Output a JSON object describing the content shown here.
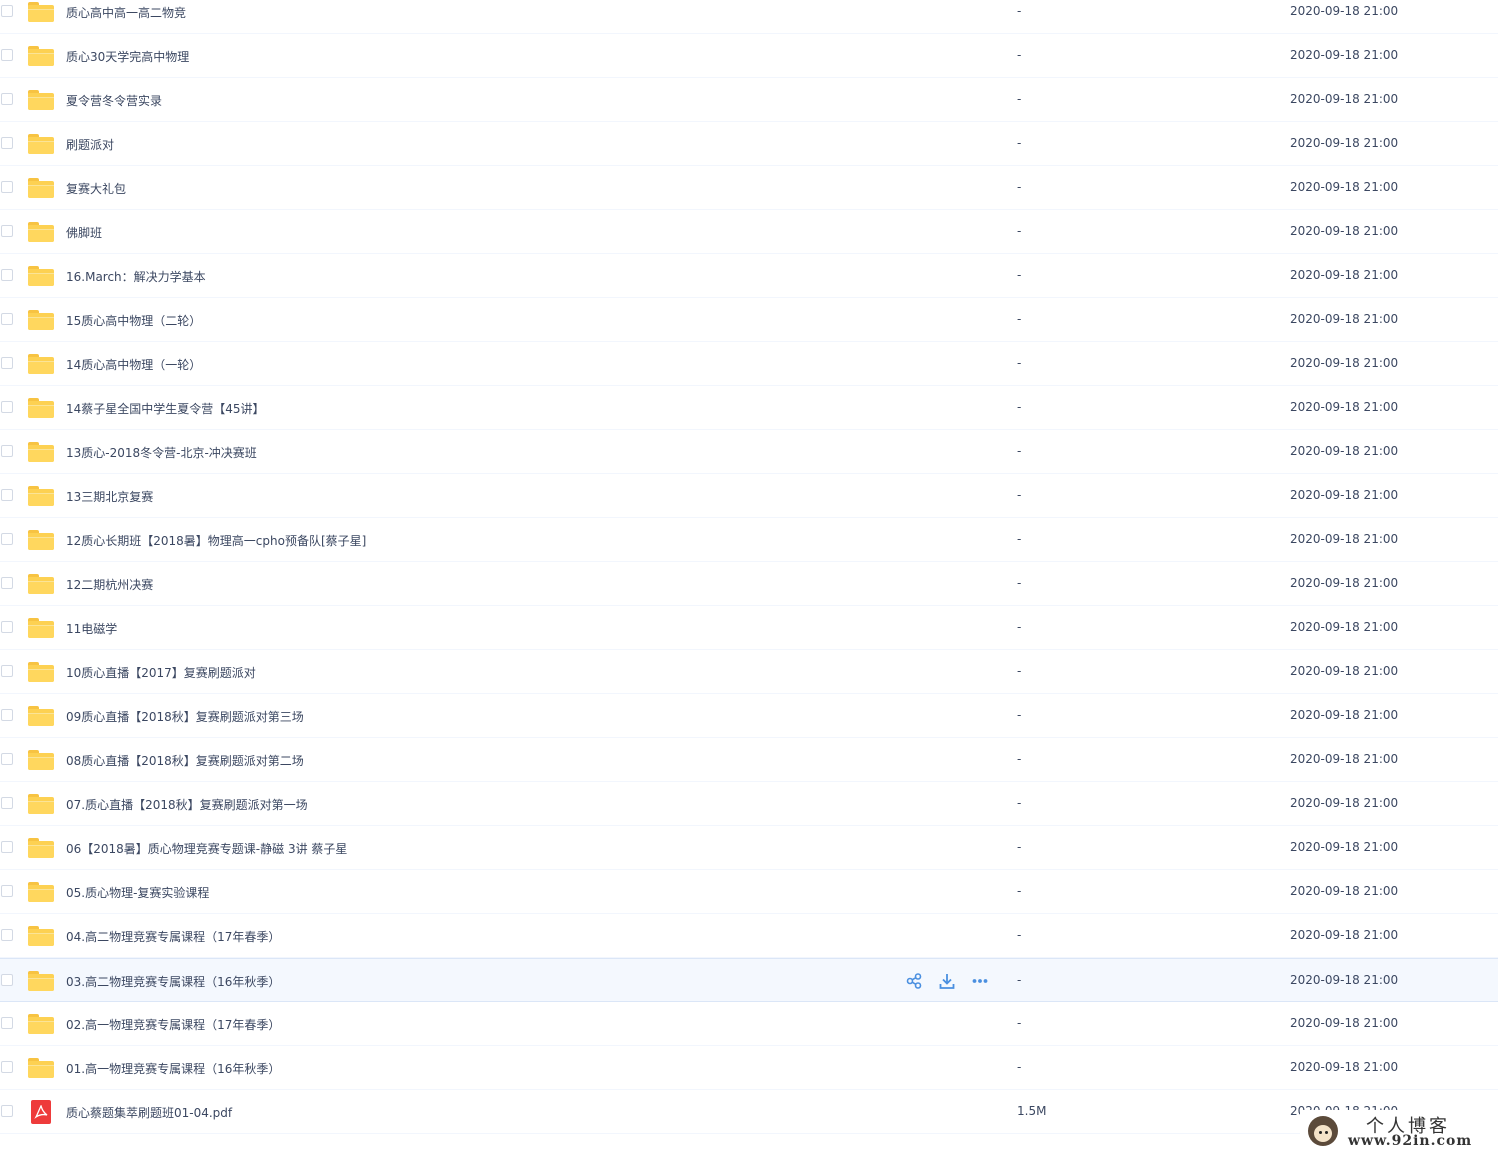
{
  "rows": [
    {
      "name": "质心高中高一高二物竞",
      "size": "-",
      "date": "2020-09-18 21:00",
      "type": "folder"
    },
    {
      "name": "质心30天学完高中物理",
      "size": "-",
      "date": "2020-09-18 21:00",
      "type": "folder"
    },
    {
      "name": "夏令营冬令营实录",
      "size": "-",
      "date": "2020-09-18 21:00",
      "type": "folder"
    },
    {
      "name": "刷题派对",
      "size": "-",
      "date": "2020-09-18 21:00",
      "type": "folder"
    },
    {
      "name": "复赛大礼包",
      "size": "-",
      "date": "2020-09-18 21:00",
      "type": "folder"
    },
    {
      "name": "佛脚班",
      "size": "-",
      "date": "2020-09-18 21:00",
      "type": "folder"
    },
    {
      "name": "16.March：解决力学基本",
      "size": "-",
      "date": "2020-09-18 21:00",
      "type": "folder"
    },
    {
      "name": "15质心高中物理（二轮）",
      "size": "-",
      "date": "2020-09-18 21:00",
      "type": "folder"
    },
    {
      "name": "14质心高中物理（一轮）",
      "size": "-",
      "date": "2020-09-18 21:00",
      "type": "folder"
    },
    {
      "name": "14蔡子星全国中学生夏令营【45讲】",
      "size": "-",
      "date": "2020-09-18 21:00",
      "type": "folder"
    },
    {
      "name": "13质心-2018冬令营-北京-冲决赛班",
      "size": "-",
      "date": "2020-09-18 21:00",
      "type": "folder"
    },
    {
      "name": "13三期北京复赛",
      "size": "-",
      "date": "2020-09-18 21:00",
      "type": "folder"
    },
    {
      "name": "12质心长期班【2018暑】物理高一cpho预备队[蔡子星]",
      "size": "-",
      "date": "2020-09-18 21:00",
      "type": "folder"
    },
    {
      "name": "12二期杭州决赛",
      "size": "-",
      "date": "2020-09-18 21:00",
      "type": "folder"
    },
    {
      "name": "11电磁学",
      "size": "-",
      "date": "2020-09-18 21:00",
      "type": "folder"
    },
    {
      "name": "10质心直播【2017】复赛刷题派对",
      "size": "-",
      "date": "2020-09-18 21:00",
      "type": "folder"
    },
    {
      "name": "09质心直播【2018秋】复赛刷题派对第三场",
      "size": "-",
      "date": "2020-09-18 21:00",
      "type": "folder"
    },
    {
      "name": "08质心直播【2018秋】复赛刷题派对第二场",
      "size": "-",
      "date": "2020-09-18 21:00",
      "type": "folder"
    },
    {
      "name": "07.质心直播【2018秋】复赛刷题派对第一场",
      "size": "-",
      "date": "2020-09-18 21:00",
      "type": "folder"
    },
    {
      "name": "06【2018暑】质心物理竞赛专题课-静磁 3讲 蔡子星",
      "size": "-",
      "date": "2020-09-18 21:00",
      "type": "folder"
    },
    {
      "name": "05.质心物理-复赛实验课程",
      "size": "-",
      "date": "2020-09-18 21:00",
      "type": "folder"
    },
    {
      "name": "04.高二物理竞赛专属课程（17年春季）",
      "size": "-",
      "date": "2020-09-18 21:00",
      "type": "folder"
    },
    {
      "name": "03.高二物理竞赛专属课程（16年秋季）",
      "size": "-",
      "date": "2020-09-18 21:00",
      "type": "folder",
      "hover": true
    },
    {
      "name": "02.高一物理竞赛专属课程（17年春季）",
      "size": "-",
      "date": "2020-09-18 21:00",
      "type": "folder"
    },
    {
      "name": "01.高一物理竞赛专属课程（16年秋季）",
      "size": "-",
      "date": "2020-09-18 21:00",
      "type": "folder"
    },
    {
      "name": "质心蔡题集萃刷题班01-04.pdf",
      "size": "1.5M",
      "date": "2020-09-18 21:00",
      "type": "pdf"
    }
  ],
  "row_actions": [
    "share-icon",
    "download-icon",
    "more-icon"
  ],
  "watermark": {
    "title": "个人博客",
    "url": "www.92in.com"
  },
  "colors": {
    "folder": "#fdd152",
    "pdf": "#ee3b3b",
    "action": "#4a8fe0",
    "hover_row": "#f4f8fe"
  }
}
